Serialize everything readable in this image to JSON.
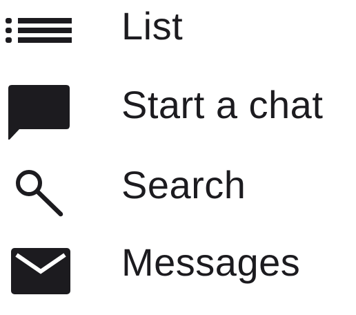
{
  "menu": {
    "items": [
      {
        "label": "List",
        "icon": "list-icon"
      },
      {
        "label": "Start a chat",
        "icon": "chat-bubble-icon"
      },
      {
        "label": "Search",
        "icon": "search-icon"
      },
      {
        "label": "Messages",
        "icon": "envelope-icon"
      }
    ]
  },
  "colors": {
    "icon": "#1c1b1f",
    "text": "#1c1b1f",
    "background": "#ffffff"
  }
}
